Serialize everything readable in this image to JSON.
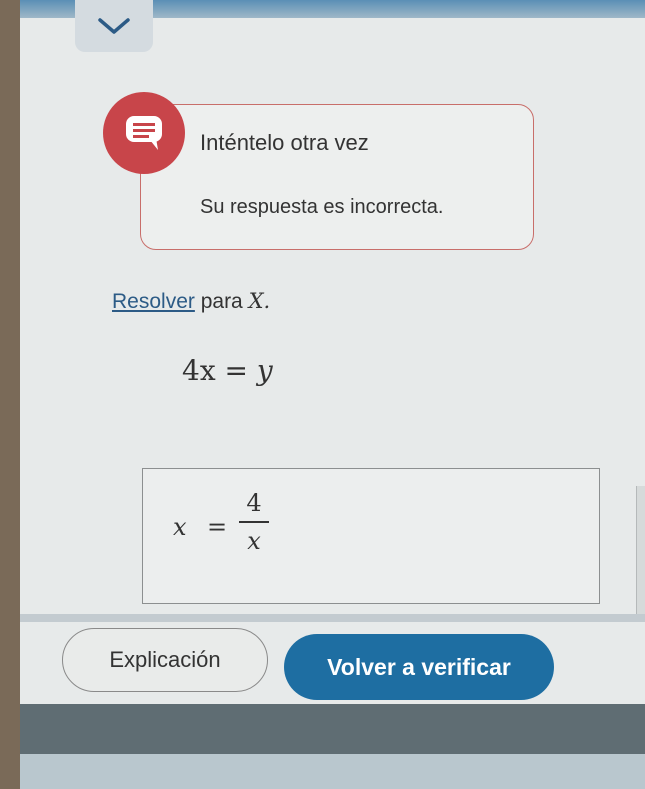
{
  "collapse": {
    "icon": "chevron-down-icon"
  },
  "feedback": {
    "icon": "chat-bubble-icon",
    "title": "Inténtelo otra vez",
    "message": "Su respuesta es incorrecta."
  },
  "problem": {
    "instruction_link": "Resolver",
    "instruction_rest": " para ",
    "instruction_var": "X.",
    "equation_lhs": "4x",
    "equation_eq": "=",
    "equation_rhs": "y"
  },
  "answer": {
    "lhs": "x",
    "eq": "=",
    "numerator": "4",
    "denominator": "x"
  },
  "buttons": {
    "explanation": "Explicación",
    "recheck": "Volver a verificar"
  },
  "colors": {
    "accent": "#1e6ea2",
    "error": "#c8454a"
  }
}
